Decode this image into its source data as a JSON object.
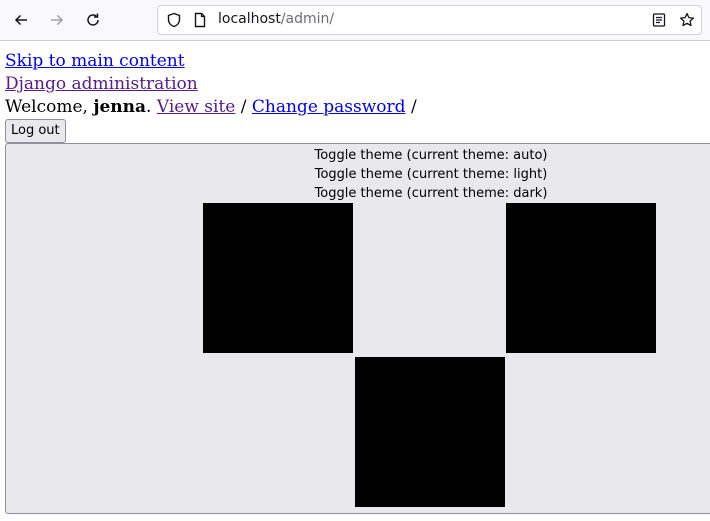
{
  "browser": {
    "url_host": "localhost",
    "url_path": "/admin/"
  },
  "page": {
    "skip_link": "Skip to main content",
    "site_name": "Django administration",
    "welcome_prefix": "Welcome,",
    "username": "jenna",
    "username_suffix": ".",
    "view_site": "View site",
    "separator": "/",
    "change_password": "Change password",
    "logout_label": "Log out",
    "theme_toggles": [
      "Toggle theme (current theme: auto)",
      "Toggle theme (current theme: light)",
      "Toggle theme (current theme: dark)"
    ]
  }
}
